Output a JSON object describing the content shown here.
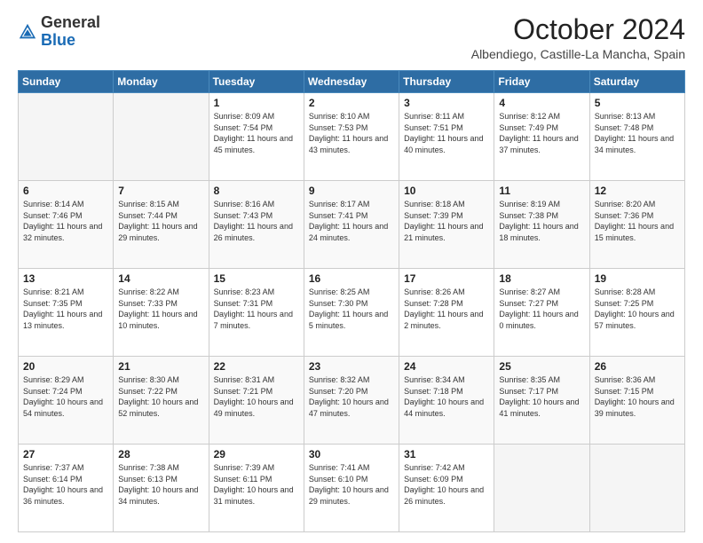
{
  "header": {
    "logo": {
      "general": "General",
      "blue": "Blue"
    },
    "title": "October 2024",
    "location": "Albendiego, Castille-La Mancha, Spain"
  },
  "calendar": {
    "days_of_week": [
      "Sunday",
      "Monday",
      "Tuesday",
      "Wednesday",
      "Thursday",
      "Friday",
      "Saturday"
    ],
    "weeks": [
      [
        {
          "day": "",
          "empty": true
        },
        {
          "day": "",
          "empty": true
        },
        {
          "day": "1",
          "sunrise": "8:09 AM",
          "sunset": "7:54 PM",
          "daylight": "11 hours and 45 minutes."
        },
        {
          "day": "2",
          "sunrise": "8:10 AM",
          "sunset": "7:53 PM",
          "daylight": "11 hours and 43 minutes."
        },
        {
          "day": "3",
          "sunrise": "8:11 AM",
          "sunset": "7:51 PM",
          "daylight": "11 hours and 40 minutes."
        },
        {
          "day": "4",
          "sunrise": "8:12 AM",
          "sunset": "7:49 PM",
          "daylight": "11 hours and 37 minutes."
        },
        {
          "day": "5",
          "sunrise": "8:13 AM",
          "sunset": "7:48 PM",
          "daylight": "11 hours and 34 minutes."
        }
      ],
      [
        {
          "day": "6",
          "sunrise": "8:14 AM",
          "sunset": "7:46 PM",
          "daylight": "11 hours and 32 minutes."
        },
        {
          "day": "7",
          "sunrise": "8:15 AM",
          "sunset": "7:44 PM",
          "daylight": "11 hours and 29 minutes."
        },
        {
          "day": "8",
          "sunrise": "8:16 AM",
          "sunset": "7:43 PM",
          "daylight": "11 hours and 26 minutes."
        },
        {
          "day": "9",
          "sunrise": "8:17 AM",
          "sunset": "7:41 PM",
          "daylight": "11 hours and 24 minutes."
        },
        {
          "day": "10",
          "sunrise": "8:18 AM",
          "sunset": "7:39 PM",
          "daylight": "11 hours and 21 minutes."
        },
        {
          "day": "11",
          "sunrise": "8:19 AM",
          "sunset": "7:38 PM",
          "daylight": "11 hours and 18 minutes."
        },
        {
          "day": "12",
          "sunrise": "8:20 AM",
          "sunset": "7:36 PM",
          "daylight": "11 hours and 15 minutes."
        }
      ],
      [
        {
          "day": "13",
          "sunrise": "8:21 AM",
          "sunset": "7:35 PM",
          "daylight": "11 hours and 13 minutes."
        },
        {
          "day": "14",
          "sunrise": "8:22 AM",
          "sunset": "7:33 PM",
          "daylight": "11 hours and 10 minutes."
        },
        {
          "day": "15",
          "sunrise": "8:23 AM",
          "sunset": "7:31 PM",
          "daylight": "11 hours and 7 minutes."
        },
        {
          "day": "16",
          "sunrise": "8:25 AM",
          "sunset": "7:30 PM",
          "daylight": "11 hours and 5 minutes."
        },
        {
          "day": "17",
          "sunrise": "8:26 AM",
          "sunset": "7:28 PM",
          "daylight": "11 hours and 2 minutes."
        },
        {
          "day": "18",
          "sunrise": "8:27 AM",
          "sunset": "7:27 PM",
          "daylight": "11 hours and 0 minutes."
        },
        {
          "day": "19",
          "sunrise": "8:28 AM",
          "sunset": "7:25 PM",
          "daylight": "10 hours and 57 minutes."
        }
      ],
      [
        {
          "day": "20",
          "sunrise": "8:29 AM",
          "sunset": "7:24 PM",
          "daylight": "10 hours and 54 minutes."
        },
        {
          "day": "21",
          "sunrise": "8:30 AM",
          "sunset": "7:22 PM",
          "daylight": "10 hours and 52 minutes."
        },
        {
          "day": "22",
          "sunrise": "8:31 AM",
          "sunset": "7:21 PM",
          "daylight": "10 hours and 49 minutes."
        },
        {
          "day": "23",
          "sunrise": "8:32 AM",
          "sunset": "7:20 PM",
          "daylight": "10 hours and 47 minutes."
        },
        {
          "day": "24",
          "sunrise": "8:34 AM",
          "sunset": "7:18 PM",
          "daylight": "10 hours and 44 minutes."
        },
        {
          "day": "25",
          "sunrise": "8:35 AM",
          "sunset": "7:17 PM",
          "daylight": "10 hours and 41 minutes."
        },
        {
          "day": "26",
          "sunrise": "8:36 AM",
          "sunset": "7:15 PM",
          "daylight": "10 hours and 39 minutes."
        }
      ],
      [
        {
          "day": "27",
          "sunrise": "7:37 AM",
          "sunset": "6:14 PM",
          "daylight": "10 hours and 36 minutes."
        },
        {
          "day": "28",
          "sunrise": "7:38 AM",
          "sunset": "6:13 PM",
          "daylight": "10 hours and 34 minutes."
        },
        {
          "day": "29",
          "sunrise": "7:39 AM",
          "sunset": "6:11 PM",
          "daylight": "10 hours and 31 minutes."
        },
        {
          "day": "30",
          "sunrise": "7:41 AM",
          "sunset": "6:10 PM",
          "daylight": "10 hours and 29 minutes."
        },
        {
          "day": "31",
          "sunrise": "7:42 AM",
          "sunset": "6:09 PM",
          "daylight": "10 hours and 26 minutes."
        },
        {
          "day": "",
          "empty": true
        },
        {
          "day": "",
          "empty": true
        }
      ]
    ]
  }
}
